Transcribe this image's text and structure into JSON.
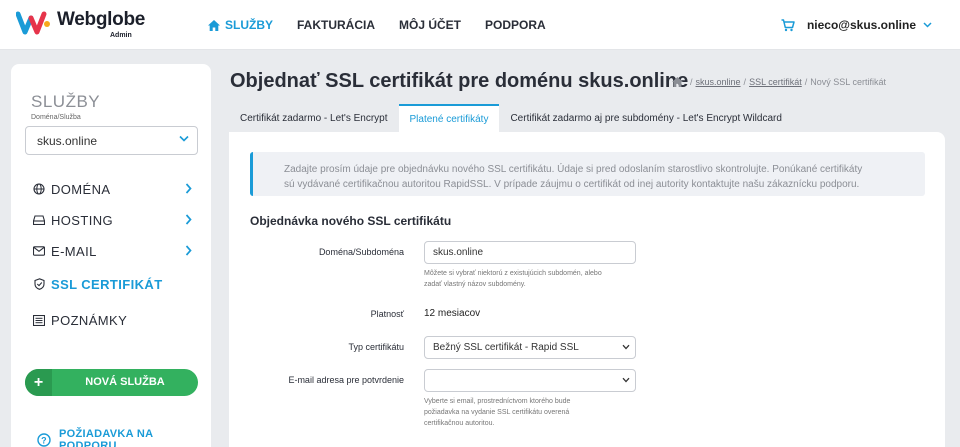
{
  "brand": {
    "name": "Webglobe",
    "sub": "Admin"
  },
  "nav": [
    {
      "label": "SLUŽBY",
      "active": true
    },
    {
      "label": "FAKTURÁCIA",
      "active": false
    },
    {
      "label": "MÔJ ÚČET",
      "active": false
    },
    {
      "label": "PODPORA",
      "active": false
    }
  ],
  "user": {
    "email": "nieco@skus.online"
  },
  "sidebar": {
    "title": "SLUŽBY",
    "select_caption": "Doména/Služba",
    "selected_domain": "skus.online",
    "items": [
      {
        "label": "DOMÉNA",
        "icon": "globe-icon"
      },
      {
        "label": "HOSTING",
        "icon": "server-icon"
      },
      {
        "label": "E-MAIL",
        "icon": "mail-icon"
      },
      {
        "label": "SSL CERTIFIKÁT",
        "icon": "shield-icon"
      },
      {
        "label": "POZNÁMKY",
        "icon": "notes-icon"
      }
    ],
    "new_service": "NOVÁ SLUŽBA",
    "support": "POŽIADAVKA NA PODPORU"
  },
  "page": {
    "title": "Objednať SSL certifikát pre doménu skus.online",
    "breadcrumbs": [
      "skus.online",
      "SSL certifikát",
      "Nový SSL certifikát"
    ]
  },
  "tabs": [
    {
      "label": "Certifikát zadarmo - Let's Encrypt",
      "active": false
    },
    {
      "label": "Platené certifikáty",
      "active": true
    },
    {
      "label": "Certifikát zadarmo aj pre subdomény - Let's Encrypt Wildcard",
      "active": false
    }
  ],
  "alert": {
    "line1": "Zadajte prosím údaje pre objednávku nového SSL certifikátu. Údaje si pred odoslaním starostlivo skontrolujte. Ponúkané certifikáty",
    "line2": "sú vydávané certifikačnou autoritou RapidSSL. V prípade záujmu o certifikát od inej autority kontaktujte našu zákaznícku podporu."
  },
  "form": {
    "title": "Objednávka nového SSL certifikátu",
    "domain": {
      "label": "Doména/Subdoména",
      "value": "skus.online",
      "help1": "Môžete si vybrať niektorú z existujúcich subdomén, alebo",
      "help2": "zadať vlastný názov subdomény."
    },
    "validity": {
      "label": "Platnosť",
      "value": "12 mesiacov"
    },
    "cert_type": {
      "label": "Typ certifikátu",
      "value": "Bežný SSL certifikát - Rapid SSL"
    },
    "email": {
      "label": "E-mail adresa pre potvrdenie",
      "value": "",
      "help1": "Vyberte si email, prostredníctvom ktorého bude",
      "help2": "požiadavka na vydanie SSL certifikátu overená",
      "help3": "certifikačnou autoritou."
    }
  },
  "colors": {
    "accent": "#1a9bd7",
    "green": "#33b15f",
    "background": "#e9ebee"
  }
}
